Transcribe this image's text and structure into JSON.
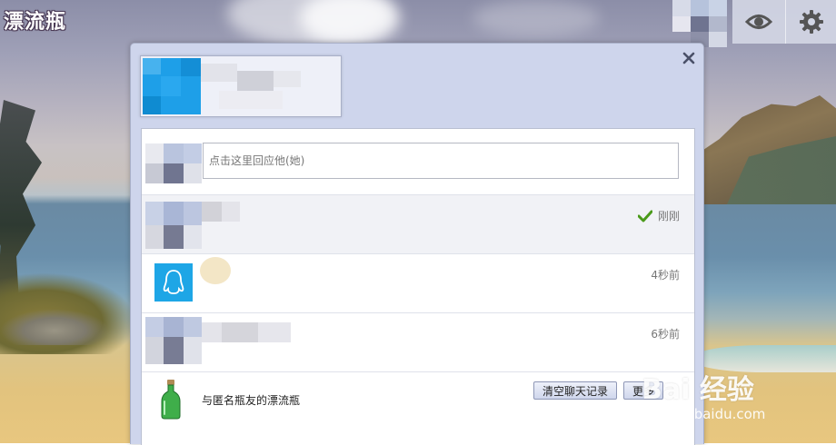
{
  "app": {
    "logo_text": "漂流瓶"
  },
  "toolbar": {
    "view_icon": "eye-icon",
    "settings_icon": "gear-icon"
  },
  "dialog": {
    "close_icon": "close-icon",
    "reply": {
      "placeholder": "点击这里回应他(她)"
    },
    "messages": [
      {
        "time": "刚刚",
        "status_icon": "check-icon"
      },
      {
        "time": "4秒前",
        "avatar_icon": "qq-penguin-icon"
      },
      {
        "time": "6秒前"
      }
    ],
    "footer": {
      "bottle_label": "与匿名瓶友的漂流瓶",
      "clear_button": "清空聊天记录",
      "more_button": "更多"
    }
  },
  "watermark": {
    "brand": "Bai 经验",
    "url": "jingyan.baidu.com"
  },
  "colors": {
    "accent": "#1ea6e6",
    "dialog_bg": "#ced5ec",
    "check": "#4a9a1a"
  }
}
